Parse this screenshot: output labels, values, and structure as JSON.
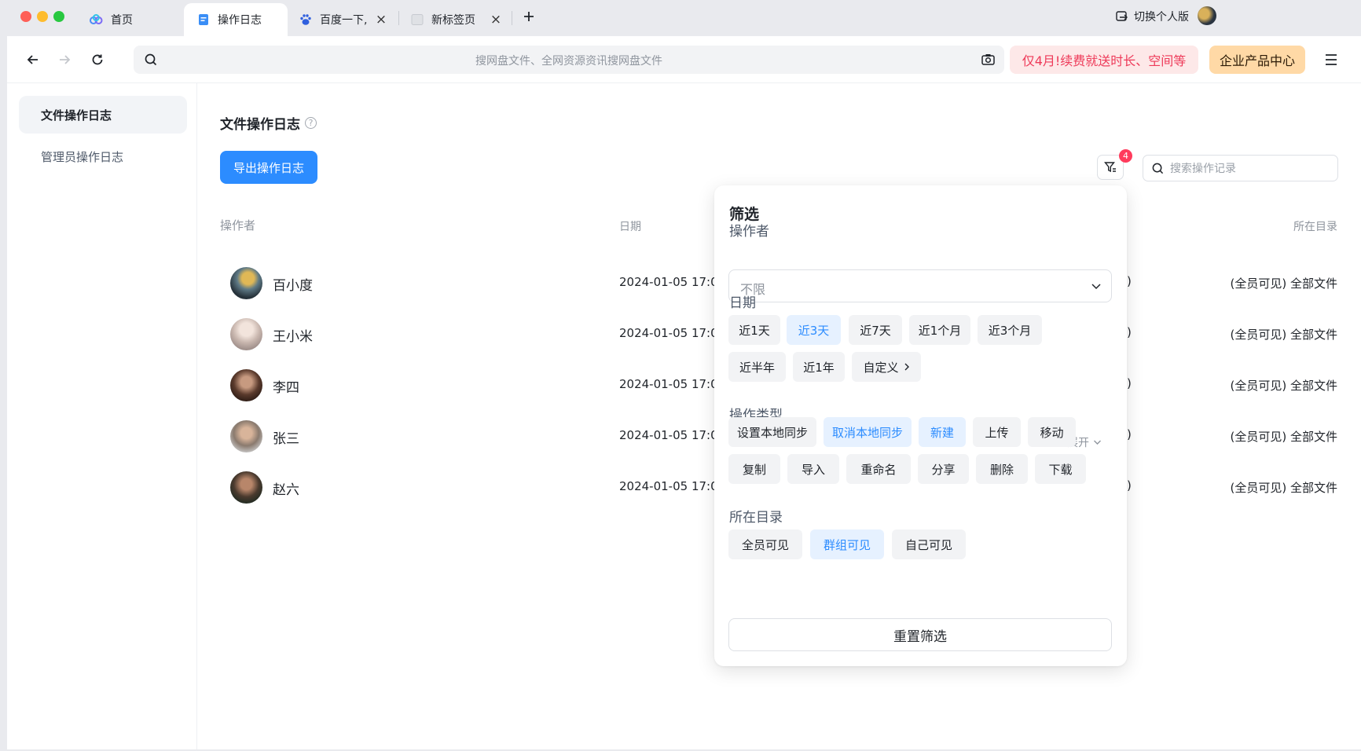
{
  "browser": {
    "tabs": [
      {
        "label": "首页",
        "icon": "baidu-netdisk-icon"
      },
      {
        "label": "操作日志",
        "icon": "doc-icon",
        "active": true
      },
      {
        "label": "百度一下,",
        "icon": "baidu-paw-icon"
      },
      {
        "label": "新标签页",
        "icon": "blank-page-icon"
      }
    ],
    "switch_label": "切换个人版",
    "address_placeholder": "搜网盘文件、全网资源资讯搜网盘文件",
    "promo_label": "仅4月!续费就送时长、空间等",
    "enterprise_label": "企业产品中心"
  },
  "sidebar": {
    "items": [
      {
        "label": "文件操作日志",
        "active": true
      },
      {
        "label": "管理员操作日志",
        "active": false
      }
    ]
  },
  "main": {
    "title": "文件操作日志",
    "help_glyph": "?",
    "export_label": "导出操作日志",
    "filter_badge": "4",
    "search_placeholder": "搜索操作记录",
    "columns": {
      "operator": "操作者",
      "date": "日期",
      "directory": "所在目录"
    },
    "rows": [
      {
        "name": "百小度",
        "date": "2024-01-05 17:06",
        "tail": ")",
        "dir": "(全员可见) 全部文件"
      },
      {
        "name": "王小米",
        "date": "2024-01-05 17:06",
        "tail": ")",
        "dir": "(全员可见) 全部文件"
      },
      {
        "name": "李四",
        "date": "2024-01-05 17:06",
        "tail": ")",
        "dir": "(全员可见) 全部文件"
      },
      {
        "name": "张三",
        "date": "2024-01-05 17:06",
        "tail": ")",
        "dir": "(全员可见) 全部文件"
      },
      {
        "name": "赵六",
        "date": "2024-01-05 17:06",
        "tail": ")",
        "dir": "(全员可见) 全部文件"
      }
    ]
  },
  "filter_panel": {
    "title": "筛选",
    "operator_label": "操作者",
    "operator_value": "不限",
    "date_label": "日期",
    "date_options": [
      "近1天",
      "近3天",
      "近7天",
      "近1个月",
      "近3个月",
      "近半年",
      "近1年",
      "自定义"
    ],
    "type_label": "操作类型",
    "expand_label": "展开",
    "type_options": [
      "设置本地同步",
      "取消本地同步",
      "新建",
      "上传",
      "移动",
      "复制",
      "导入",
      "重命名",
      "分享",
      "删除",
      "下载"
    ],
    "dir_label": "所在目录",
    "dir_options": [
      "全员可见",
      "群组可见",
      "自己可见"
    ],
    "reset_label": "重置筛选"
  },
  "colors": {
    "accent": "#2c8cff",
    "badge": "#ff3b5c",
    "promo_text": "#ee3a59",
    "enterprise_bg": "#ffd9a6"
  }
}
